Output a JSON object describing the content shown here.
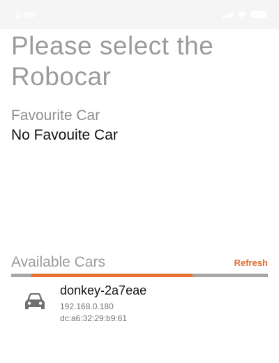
{
  "status_bar": {
    "time": "2:00"
  },
  "title": "Please select the Robocar",
  "favourite": {
    "label": "Favourite Car",
    "value": "No Favouite Car"
  },
  "available": {
    "label": "Available Cars",
    "refresh_label": "Refresh",
    "scanning_progress": {
      "indicator": "indeterminate",
      "fill_color": "#e8702e",
      "track_color": "#a6a6a6"
    }
  },
  "cars": [
    {
      "name": "donkey-2a7eae",
      "ip": "192.168.0.180",
      "mac": "dc:a6:32:29:b9:61",
      "icon": "car-icon"
    }
  ],
  "colors": {
    "accent": "#e06b2e",
    "title_gray": "#9b9b9b"
  }
}
